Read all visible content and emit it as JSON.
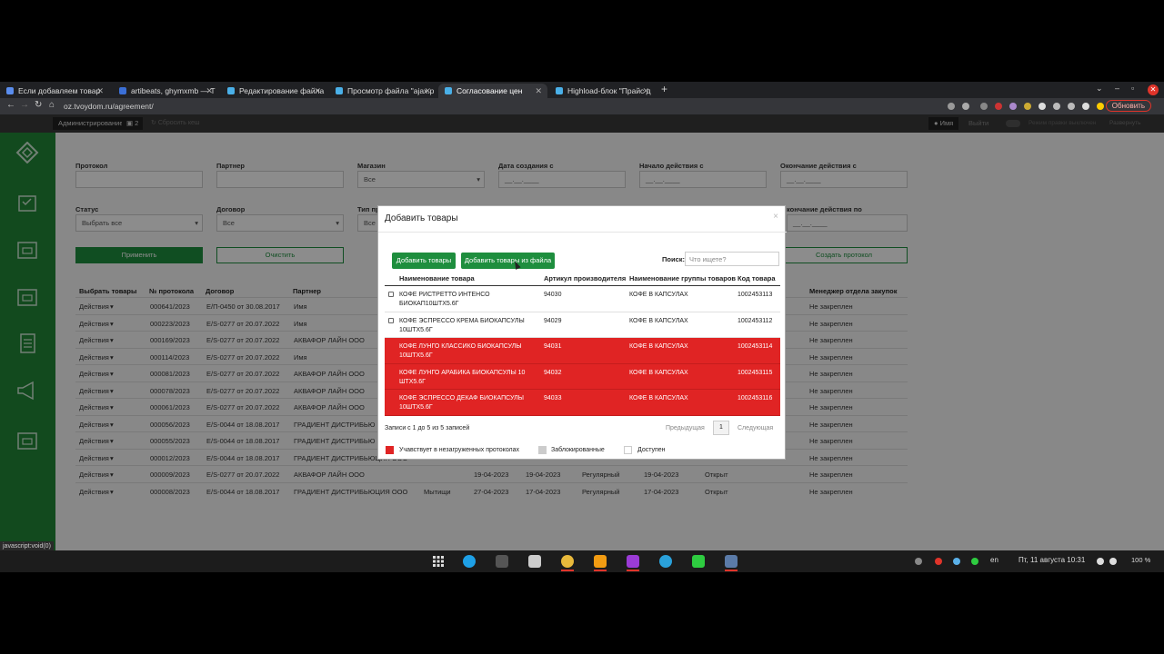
{
  "browser": {
    "tabs": [
      {
        "label": "Если добавляем товар"
      },
      {
        "label": "artibeats, ghymxmb — Т"
      },
      {
        "label": "Редактирование файла"
      },
      {
        "label": "Просмотр файла \"ajax.p"
      },
      {
        "label": "Согласование цен"
      },
      {
        "label": "Highload-блок \"Прайс д"
      }
    ],
    "url": "oz.tvoydom.ru/agreement/",
    "update_label": "Обновить"
  },
  "site_header": {
    "admin_label": "Администрирование",
    "notif_count": "2",
    "reset_cache_label": "Сбросить кеш",
    "user_label": "Имя",
    "logout_label": "Выйти",
    "mode_label": "Режим правки",
    "mode_state": "выключен",
    "expand_label": "Развернуть"
  },
  "filters": {
    "protocol_label": "Протокол",
    "partner_label": "Партнер",
    "stores_label": "Магазин",
    "stores_value": "Все",
    "created_from_label": "Дата создания с",
    "created_from_placeholder": "__.__.____",
    "start_from_label": "Начало действия с",
    "start_from_placeholder": "__.__.____",
    "end_from_label": "Окончание действия с",
    "end_from_placeholder": "__.__.____",
    "status_label": "Статус",
    "status_value": "Выбрать все",
    "contract_label": "Договор",
    "contract_value": "Все",
    "type_label": "Тип пр",
    "type_value": "Все",
    "end_to_label": "кончание действия по",
    "end_to_placeholder": "__.__.____",
    "apply_label": "Применить",
    "clear_label": "Очистить",
    "create_label": "Создать протокол"
  },
  "bg_table": {
    "headers": {
      "select": "Выбрать товары",
      "protocol": "№ протокола",
      "contract": "Договор",
      "partner": "Партнер",
      "manager": "Менеджер отдела закупок"
    },
    "actions_label": "Действия",
    "rows": [
      {
        "protocol": "000641/2023",
        "contract": "E/П-0450 от 30.08.2017",
        "partner": "Имя",
        "manager": "Не закреплен"
      },
      {
        "protocol": "000223/2023",
        "contract": "E/S-0277 от 20.07.2022",
        "partner": "Имя",
        "manager": "Не закреплен"
      },
      {
        "protocol": "000169/2023",
        "contract": "E/S-0277 от 20.07.2022",
        "partner": "АКВАФОР ЛАЙН ООО",
        "manager": "Не закреплен"
      },
      {
        "protocol": "000114/2023",
        "contract": "E/S-0277 от 20.07.2022",
        "partner": "Имя",
        "manager": "Не закреплен"
      },
      {
        "protocol": "000081/2023",
        "contract": "E/S-0277 от 20.07.2022",
        "partner": "АКВАФОР ЛАЙН ООО",
        "manager": "Не закреплен"
      },
      {
        "protocol": "000078/2023",
        "contract": "E/S-0277 от 20.07.2022",
        "partner": "АКВАФОР ЛАЙН ООО",
        "manager": "Не закреплен"
      },
      {
        "protocol": "000061/2023",
        "contract": "E/S-0277 от 20.07.2022",
        "partner": "АКВАФОР ЛАЙН ООО",
        "manager": "Не закреплен"
      },
      {
        "protocol": "000056/2023",
        "contract": "E/S-0044 от 18.08.2017",
        "partner": "ГРАДИЕНТ ДИСТРИБЬЮ",
        "manager": "Не закреплен"
      },
      {
        "protocol": "000055/2023",
        "contract": "E/S-0044 от 18.08.2017",
        "partner": "ГРАДИЕНТ ДИСТРИБЬЮ",
        "manager": "Не закреплен"
      },
      {
        "protocol": "000012/2023",
        "contract": "E/S-0044 от 18.08.2017",
        "partner": "ГРАДИЕНТ ДИСТРИБЬЮЦИЯ ООО",
        "manager": "Не закреплен"
      },
      {
        "protocol": "000009/2023",
        "contract": "E/S-0277 от 20.07.2022",
        "partner": "АКВАФОР ЛАЙН ООО",
        "date1": "19-04-2023",
        "date2": "19-04-2023",
        "type": "Регулярный",
        "date3": "19-04-2023",
        "status": "Открыт",
        "manager": "Не закреплен"
      },
      {
        "protocol": "000008/2023",
        "contract": "E/S-0044 от 18.08.2017",
        "partner": "ГРАДИЕНТ ДИСТРИБЬЮЦИЯ ООО",
        "store": "Мытищи",
        "date1": "27-04-2023",
        "date2": "17-04-2023",
        "type": "Регулярный",
        "date3": "17-04-2023",
        "status": "Открыт",
        "manager": "Не закреплен"
      }
    ]
  },
  "modal": {
    "title": "Добавить товары",
    "close": "×",
    "add_label": "Добавить товары",
    "add_file_label": "Добавить товары из файла",
    "search_label": "Поиск:",
    "search_placeholder": "Что ищете?",
    "headers": {
      "name": "Наименование товара",
      "article": "Артикул производителя",
      "group": "Наименование группы товаров",
      "code": "Код товара"
    },
    "rows": [
      {
        "name": "КОФЕ РИСТРЕТТО ИНТЕНСО БИОКАП10ШТХ5.6Г",
        "article": "94030",
        "group": "КОФЕ В КАПСУЛАХ",
        "code": "1002453113",
        "state": "available"
      },
      {
        "name": "КОФЕ ЭСПРЕССО КРЕМА БИОКАПСУЛЫ 10ШТХ5.6Г",
        "article": "94029",
        "group": "КОФЕ В КАПСУЛАХ",
        "code": "1002453112",
        "state": "available"
      },
      {
        "name": "КОФЕ ЛУНГО КЛАССИКО БИОКАПСУЛЫ 10ШТХ5.6Г",
        "article": "94031",
        "group": "КОФЕ В КАПСУЛАХ",
        "code": "1002453114",
        "state": "in-protocol"
      },
      {
        "name": "КОФЕ ЛУНГО АРАБИКА БИОКАПСУЛЫ 10 ШТХ5.6Г",
        "article": "94032",
        "group": "КОФЕ В КАПСУЛАХ",
        "code": "1002453115",
        "state": "in-protocol"
      },
      {
        "name": "КОФЕ ЭСПРЕССО ДЕКАФ БИОКАПСУЛЫ 10ШТХ5.6Г",
        "article": "94033",
        "group": "КОФЕ В КАПСУЛАХ",
        "code": "1002453116",
        "state": "in-protocol"
      }
    ],
    "records_info": "Записи с 1 до 5 из 5 записей",
    "prev_label": "Предыдущая",
    "page": "1",
    "next_label": "Следующая",
    "legend": {
      "in_protocol": "Учавствует в незагруженных протоколах",
      "blocked": "Заблокированные",
      "available": "Доступен"
    },
    "colors": {
      "in_protocol": "#e02424",
      "blocked": "#cccccc",
      "available": "#ffffff"
    }
  },
  "status_hover": "javascript:void(0)",
  "taskbar": {
    "lang": "en",
    "datetime": "Пт, 11 августа  10:31",
    "volume": "100 %"
  },
  "colors": {
    "brand_green": "#218838",
    "accent_red": "#e02424"
  }
}
